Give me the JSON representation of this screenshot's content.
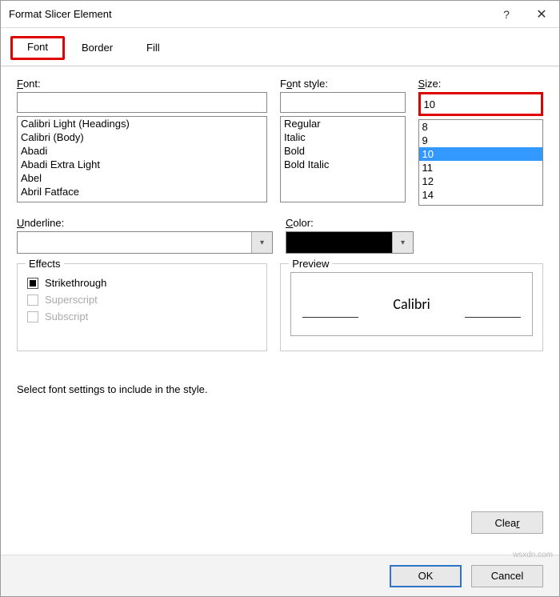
{
  "titlebar": {
    "title": "Format Slicer Element",
    "help": "?",
    "close": "✕"
  },
  "tabs": {
    "font": "Font",
    "border": "Border",
    "fill": "Fill"
  },
  "font": {
    "label": "Font:",
    "value": "",
    "items": [
      "Calibri Light (Headings)",
      "Calibri (Body)",
      "Abadi",
      "Abadi Extra Light",
      "Abel",
      "Abril Fatface"
    ]
  },
  "style": {
    "label": "Font style:",
    "value": "",
    "items": [
      "Regular",
      "Italic",
      "Bold",
      "Bold Italic"
    ]
  },
  "size": {
    "label": "Size:",
    "value": "10",
    "items": [
      "8",
      "9",
      "10",
      "11",
      "12",
      "14"
    ],
    "selected": "10"
  },
  "underline": {
    "label": "Underline:"
  },
  "color": {
    "label": "Color:",
    "swatch": "#000000"
  },
  "effects": {
    "legend": "Effects",
    "strike": "Strikethrough",
    "super": "Superscript",
    "sub": "Subscript"
  },
  "preview": {
    "legend": "Preview",
    "text": "Calibri"
  },
  "help_text": "Select font settings to include in the style.",
  "buttons": {
    "clear": "Clear",
    "ok": "OK",
    "cancel": "Cancel"
  },
  "watermark": "wsxdn.com"
}
